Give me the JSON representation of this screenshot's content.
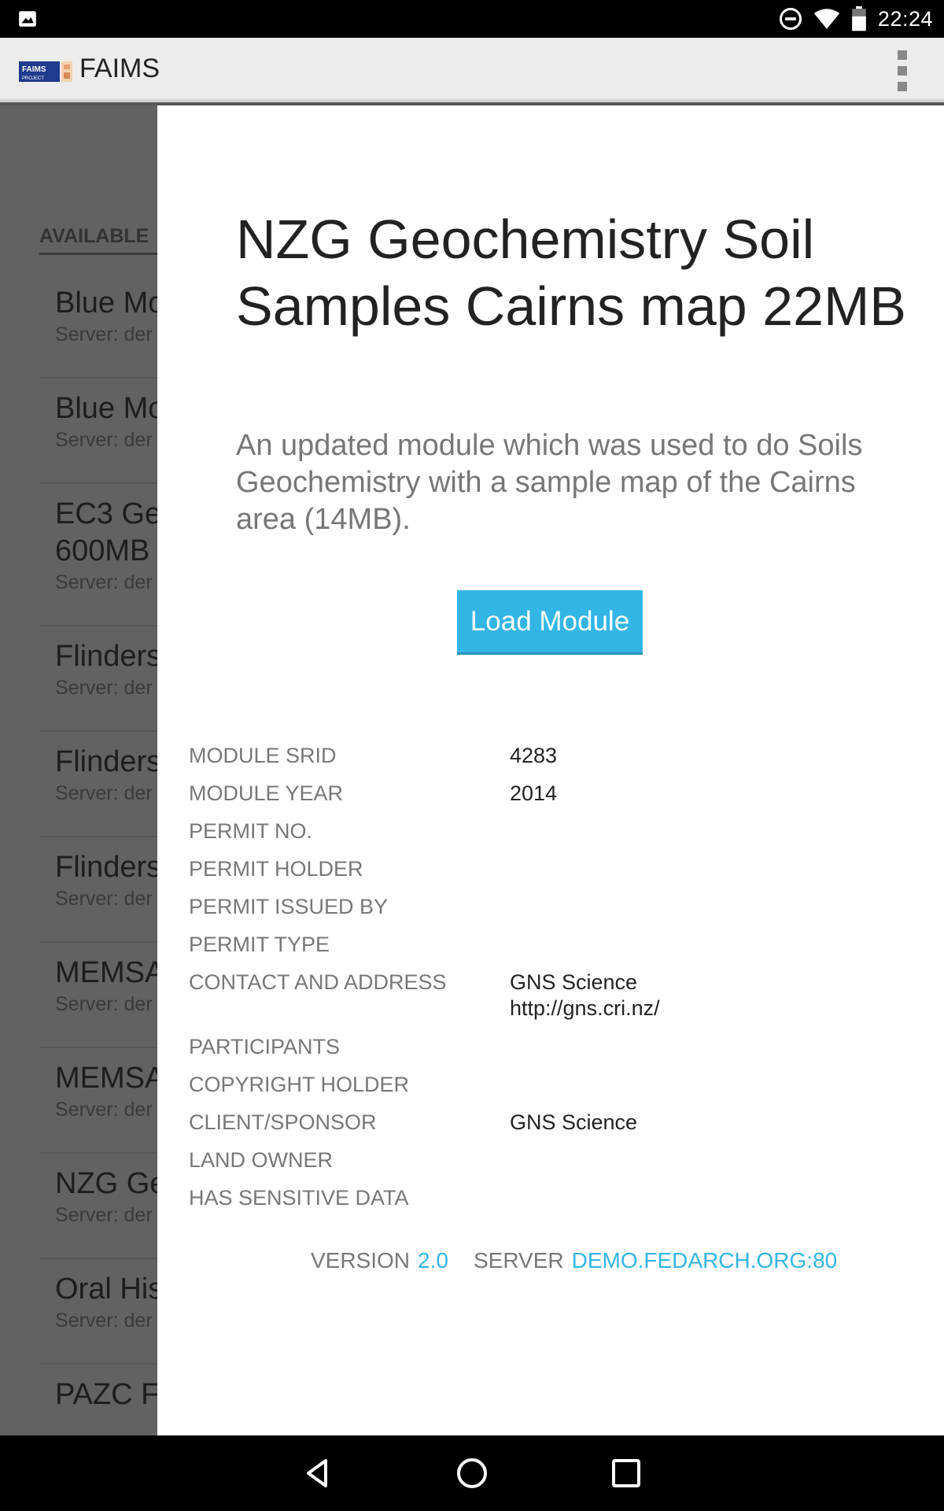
{
  "status_bar": {
    "time": "22:24",
    "icons": [
      "image-icon",
      "do-not-disturb-icon",
      "wifi-icon",
      "battery-icon"
    ]
  },
  "app_bar": {
    "title": "FAIMS",
    "logo_text": "FAIMS PROJECT",
    "overflow_icon": "more-vert-icon"
  },
  "background_list": {
    "section_label": "AVAILABLE",
    "items": [
      {
        "title": "Blue Mo",
        "subtitle": "Server: der"
      },
      {
        "title": "Blue Mo",
        "subtitle": "Server: der"
      },
      {
        "title": "EC3 Ge",
        "title2": "600MB",
        "subtitle": "Server: der"
      },
      {
        "title": "Flinders",
        "subtitle": "Server: der"
      },
      {
        "title": "Flinders",
        "subtitle": "Server: der"
      },
      {
        "title": "Flinders",
        "subtitle": "Server: der"
      },
      {
        "title": "MEMSA",
        "subtitle": "Server: der"
      },
      {
        "title": "MEMSA",
        "subtitle": "Server: der"
      },
      {
        "title": "NZG Ge",
        "subtitle": "Server: der"
      },
      {
        "title": "Oral His",
        "subtitle": "Server: der"
      },
      {
        "title": "PAZC F",
        "subtitle": ""
      }
    ]
  },
  "dialog": {
    "title": "NZG Geochemistry Soil Samples Cairns map 22MB",
    "description": "An updated module which was used to do Soils Geochemistry with a sample map of the Cairns area (14MB).",
    "load_button": "Load Module",
    "metadata": [
      {
        "key": "MODULE SRID",
        "value": "4283"
      },
      {
        "key": "MODULE YEAR",
        "value": "2014"
      },
      {
        "key": "PERMIT NO.",
        "value": ""
      },
      {
        "key": "PERMIT HOLDER",
        "value": ""
      },
      {
        "key": "PERMIT ISSUED BY",
        "value": ""
      },
      {
        "key": "PERMIT TYPE",
        "value": ""
      },
      {
        "key": "CONTACT AND ADDRESS",
        "value": "GNS Science",
        "value2": "http://gns.cri.nz/"
      },
      {
        "key": "PARTICIPANTS",
        "value": ""
      },
      {
        "key": "COPYRIGHT HOLDER",
        "value": ""
      },
      {
        "key": "CLIENT/SPONSOR",
        "value": "GNS Science"
      },
      {
        "key": "LAND OWNER",
        "value": ""
      },
      {
        "key": "HAS SENSITIVE DATA",
        "value": ""
      }
    ],
    "footer": {
      "version_label": "VERSION",
      "version_value": "2.0",
      "server_label": "SERVER",
      "server_value": "DEMO.FEDARCH.ORG:80"
    }
  },
  "nav_bar": {
    "buttons": [
      "back-icon",
      "home-icon",
      "recents-icon"
    ]
  },
  "colors": {
    "accent": "#33b5e5",
    "overlay": "#626262"
  }
}
